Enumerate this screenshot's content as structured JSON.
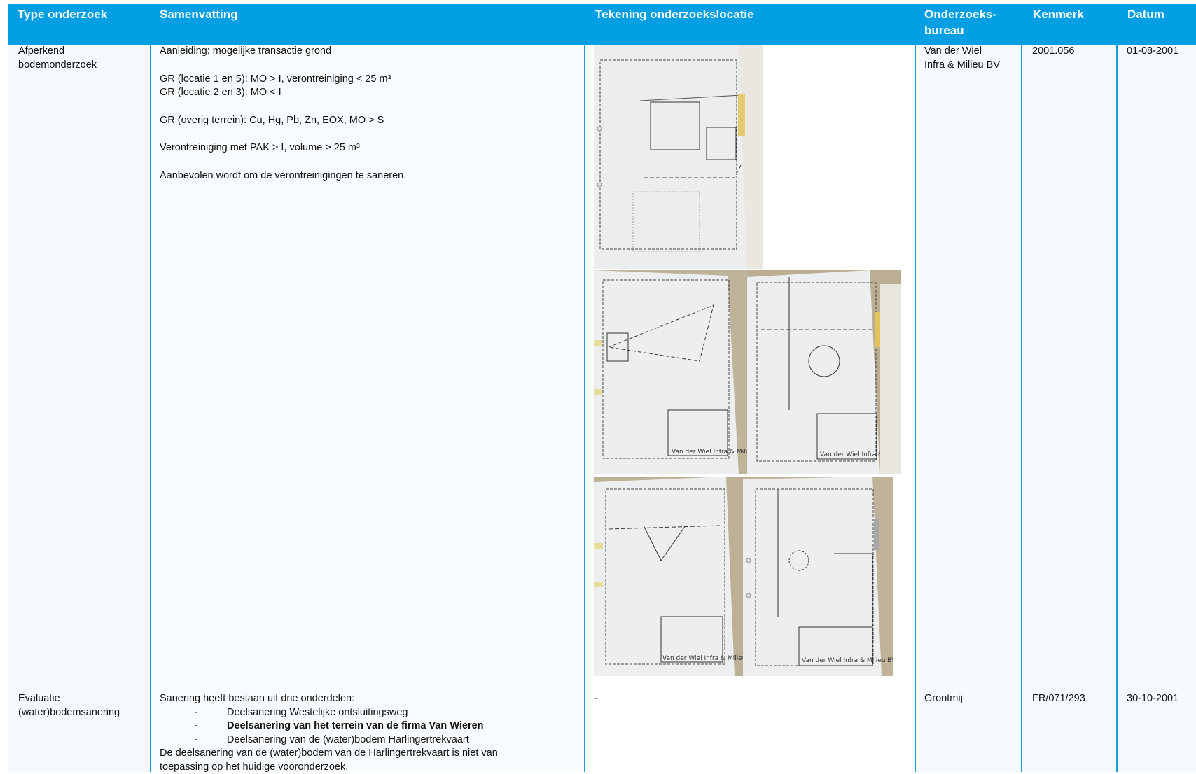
{
  "header": {
    "type": "Type onderzoek",
    "summary": "Samenvatting",
    "drawing": "Tekening onderzoekslocatie",
    "bureau_1": "Onderzoeks-",
    "bureau_2": "bureau",
    "kenmerk": "Kenmerk",
    "datum": "Datum"
  },
  "rows": [
    {
      "type_1": "Afperkend",
      "type_2": "bodemonderzoek",
      "summary": [
        "Aanleiding: mogelijke transactie grond",
        "GR (locatie 1 en 5): MO > I, verontreiniging < 25 m³",
        "GR (locatie 2 en 3): MO < I",
        "GR (overig terrein): Cu, Hg, Pb, Zn, EOX, MO > S",
        "Verontreiniging met PAK > I, volume > 25 m³",
        "Aanbevolen wordt om de verontreinigingen te saneren."
      ],
      "drawing_caption": "Van der Wiel Infra & Milieu BV",
      "bureau_1": "Van der Wiel",
      "bureau_2": "Infra & Milieu BV",
      "kenmerk": "2001.056",
      "datum": "01-08-2001"
    },
    {
      "type_1": "Evaluatie",
      "type_2": "(water)bodemsanering",
      "intro": "Sanering heeft bestaan uit drie onderdelen:",
      "bullet_dash": "-",
      "bullets": [
        "Deelsanering Westelijke ontsluitingsweg",
        "Deelsanering van het terrein van de firma Van Wieren",
        "Deelsanering van de (water)bodem Harlingertrekvaart"
      ],
      "outro_1": "De deelsanering van de (water)bodem van de Harlingertrekvaart is niet van",
      "outro_2": "toepassing op het huidige vooronderzoek.",
      "drawing": "-",
      "bureau": "Grontmij",
      "kenmerk": "FR/071/293",
      "datum": "30-10-2001"
    }
  ]
}
